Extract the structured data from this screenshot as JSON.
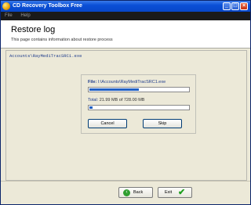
{
  "window": {
    "title": "CD Recovery Toolbox Free",
    "controls": {
      "minimize": "_",
      "maximize": "□",
      "close": "×"
    }
  },
  "menu": {
    "items": [
      "File",
      "Help"
    ]
  },
  "header": {
    "title": "Restore log",
    "subtitle": "This page contains information about restore process"
  },
  "log": {
    "line": "Accounts\\RayMediTracSRC1.exe"
  },
  "progress": {
    "file_label": "File:",
    "file_path": "I:\\Accounts\\RayMediTracSRC1.exe",
    "file_fraction": 0.5,
    "total_label": "Total:",
    "total_text": "21.99 MB of 728.00 MB",
    "total_fraction": 0.03
  },
  "buttons": {
    "cancel": "Cancel",
    "skip": "Skip",
    "back": "Back",
    "exit": "Exit"
  },
  "icons": {
    "app": "cd-icon",
    "back": "back-arrow-icon",
    "exit": "checkmark-icon"
  }
}
